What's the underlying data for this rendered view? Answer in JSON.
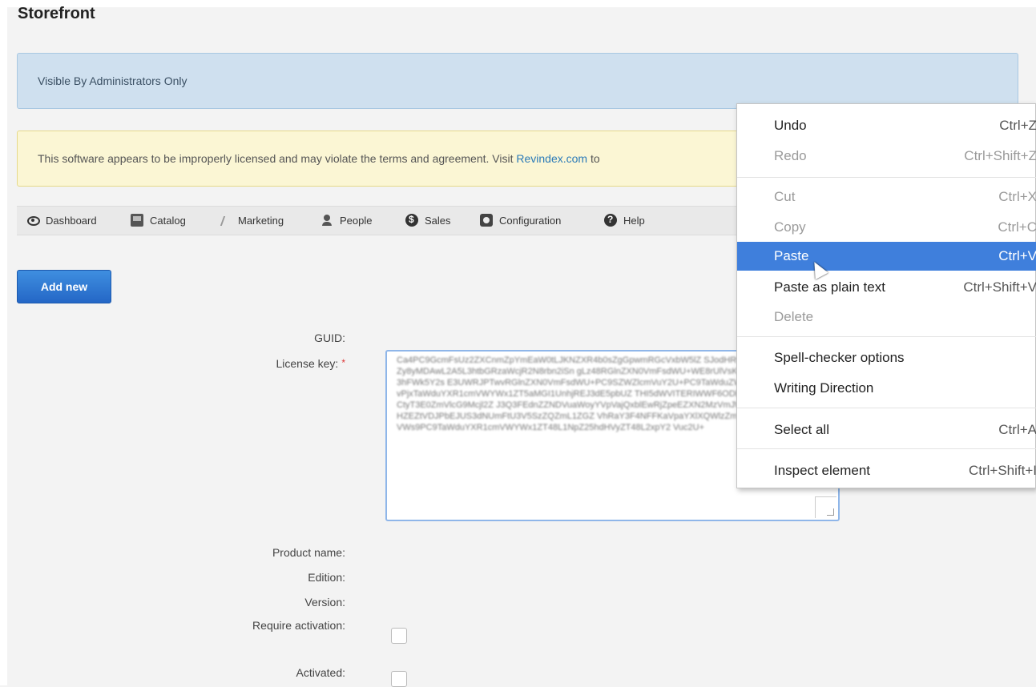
{
  "page": {
    "title": "Storefront"
  },
  "alerts": {
    "info": "Visible By Administrators Only",
    "license_prefix": "This software appears to be improperly licensed and may violate the terms and agreement. Visit ",
    "license_link": "Revindex.com",
    "license_suffix": " to"
  },
  "nav": {
    "items": [
      {
        "label": "Dashboard",
        "icon": "eye-icon"
      },
      {
        "label": "Catalog",
        "icon": "catalog-icon"
      },
      {
        "label": "Marketing",
        "icon": "marketing-icon"
      },
      {
        "label": "People",
        "icon": "person-icon"
      },
      {
        "label": "Sales",
        "icon": "dollar-icon"
      },
      {
        "label": "Configuration",
        "icon": "config-icon"
      },
      {
        "label": "Help",
        "icon": "help-icon"
      }
    ]
  },
  "actions": {
    "add_new": "Add new"
  },
  "form": {
    "guid_label": "GUID:",
    "license_key_label": "License key:",
    "required_marker": "*",
    "license_key_value": "Ca4PC9GcmFsUz2ZXCnmZpYmEaW0tLJKNZXR4b0sZgGpwmRGcVxbW5lZ SJodHRwOi8vd3d3LnczLmI9yZy8yMDAwL2A5L3htbGRzaWcjR2N8rbn2iSn gLz48RGlnZXN0VmFsdWU+WE8rUlVsK05NL2I3c044VUJoIRK3hFWk5Y2s E3UWRJPTwvRGlnZXN0VmFsdWU+PC9SZWZlcmVuY2U+PC9TaWduZWRJbmZv uZWRJbmZvPjxTaWduYXR1cmVWYWx1ZT5aMGI1UnhjREJ3dE5pbUZ THI5dWVITERIWWF6ODBEWHdXZDAvdFcwMCtyT3E0ZmVlcG9Mcjl2Z J3Q3FEdnZZNDVuaWoyYVpVajQxblEwRjZpeEZXN2MzVmJWbDRnS FRaytMMmNHZEZtVDJPbEJUS3dNUmFtU3V5SzZQZmL1ZGZ VhRaY3F4NFFKaVpaYXlXQWlzZmpCV3VRdy9Hcnl4N2J VWs9PC9TaWduYXR1cmVWYWx1ZT48L1NpZ25hdHVyZT48L2xpY2 Vuc2U+"
  },
  "product": {
    "product_name_label": "Product name:",
    "edition_label": "Edition:",
    "version_label": "Version:",
    "require_activation_label": "Require activation:",
    "activated_label": "Activated:"
  },
  "context_menu": {
    "items": [
      {
        "label": "Undo",
        "shortcut": "Ctrl+Z",
        "state": "enabled"
      },
      {
        "label": "Redo",
        "shortcut": "Ctrl+Shift+Z",
        "state": "disabled"
      },
      {
        "label": "Cut",
        "shortcut": "Ctrl+X",
        "state": "disabled"
      },
      {
        "label": "Copy",
        "shortcut": "Ctrl+C",
        "state": "disabled"
      },
      {
        "label": "Paste",
        "shortcut": "Ctrl+V",
        "state": "highlighted"
      },
      {
        "label": "Paste as plain text",
        "shortcut": "Ctrl+Shift+V",
        "state": "enabled"
      },
      {
        "label": "Delete",
        "shortcut": "",
        "state": "disabled"
      },
      {
        "label": "Spell-checker options",
        "shortcut": "",
        "state": "enabled"
      },
      {
        "label": "Writing Direction",
        "shortcut": "",
        "state": "enabled"
      },
      {
        "label": "Select all",
        "shortcut": "Ctrl+A",
        "state": "enabled"
      },
      {
        "label": "Inspect element",
        "shortcut": "Ctrl+Shift+I",
        "state": "enabled"
      }
    ]
  },
  "colors": {
    "background": "#f3f3f3",
    "info_alert": "#cfe0ef",
    "warning_alert": "#fbf6d4",
    "primary_button": "#2e7ad6",
    "menu_highlight": "#3f7fdc",
    "link": "#2a7ab8"
  }
}
